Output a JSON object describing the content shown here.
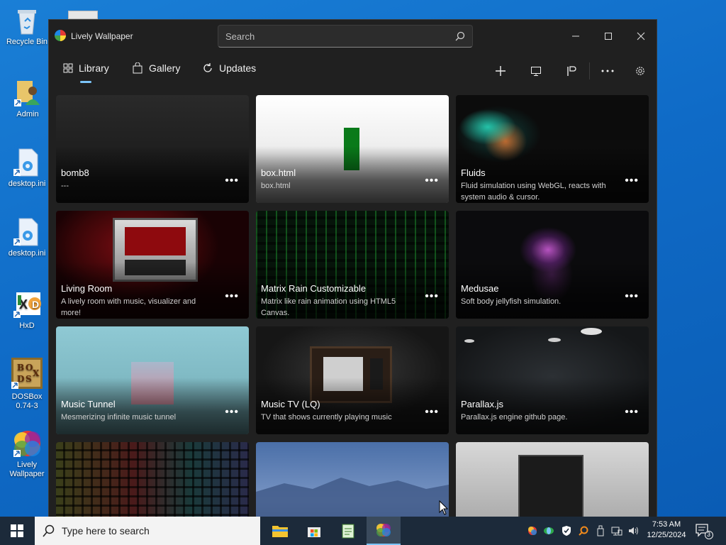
{
  "desktop": {
    "icons": [
      {
        "label": "Recycle Bin"
      },
      {
        "label": "Admin"
      },
      {
        "label": "desktop.ini"
      },
      {
        "label": "desktop.ini"
      },
      {
        "label": "HxD"
      },
      {
        "label": "DOSBox 0.74-3"
      },
      {
        "label": "Lively Wallpaper"
      }
    ]
  },
  "window": {
    "title": "Lively Wallpaper",
    "search_placeholder": "Search",
    "nav": [
      {
        "label": "Library",
        "icon": "grid-icon",
        "selected": true
      },
      {
        "label": "Gallery",
        "icon": "shopping-bag-icon"
      },
      {
        "label": "Updates",
        "icon": "refresh-icon"
      }
    ],
    "toolbar_icons": [
      "add-icon",
      "monitor-icon",
      "control-panel-icon",
      "more-icon",
      "settings-icon"
    ],
    "accent": "#7cc4f8"
  },
  "library": [
    {
      "title": "bomb8",
      "desc": "---"
    },
    {
      "title": "box.html",
      "desc": "box.html"
    },
    {
      "title": "Fluids",
      "desc": "Fluid simulation using WebGL, reacts with system audio & cursor."
    },
    {
      "title": "Living Room",
      "desc": "A lively room with music, visualizer and more!"
    },
    {
      "title": "Matrix Rain Customizable",
      "desc": "Matrix like rain animation using HTML5 Canvas."
    },
    {
      "title": "Medusae",
      "desc": "Soft body jellyfish simulation."
    },
    {
      "title": "Music Tunnel",
      "desc": "Mesmerizing infinite music tunnel"
    },
    {
      "title": "Music TV (LQ)",
      "desc": "TV that shows currently playing music"
    },
    {
      "title": "Parallax.js",
      "desc": "Parallax.js engine github page."
    },
    {
      "title": "",
      "desc": ""
    },
    {
      "title": "",
      "desc": ""
    },
    {
      "title": "",
      "desc": ""
    }
  ],
  "more_label": "•••",
  "taskbar": {
    "search_placeholder": "Type here to search",
    "time": "7:53 AM",
    "date": "12/25/2024",
    "notification_count": "3"
  }
}
